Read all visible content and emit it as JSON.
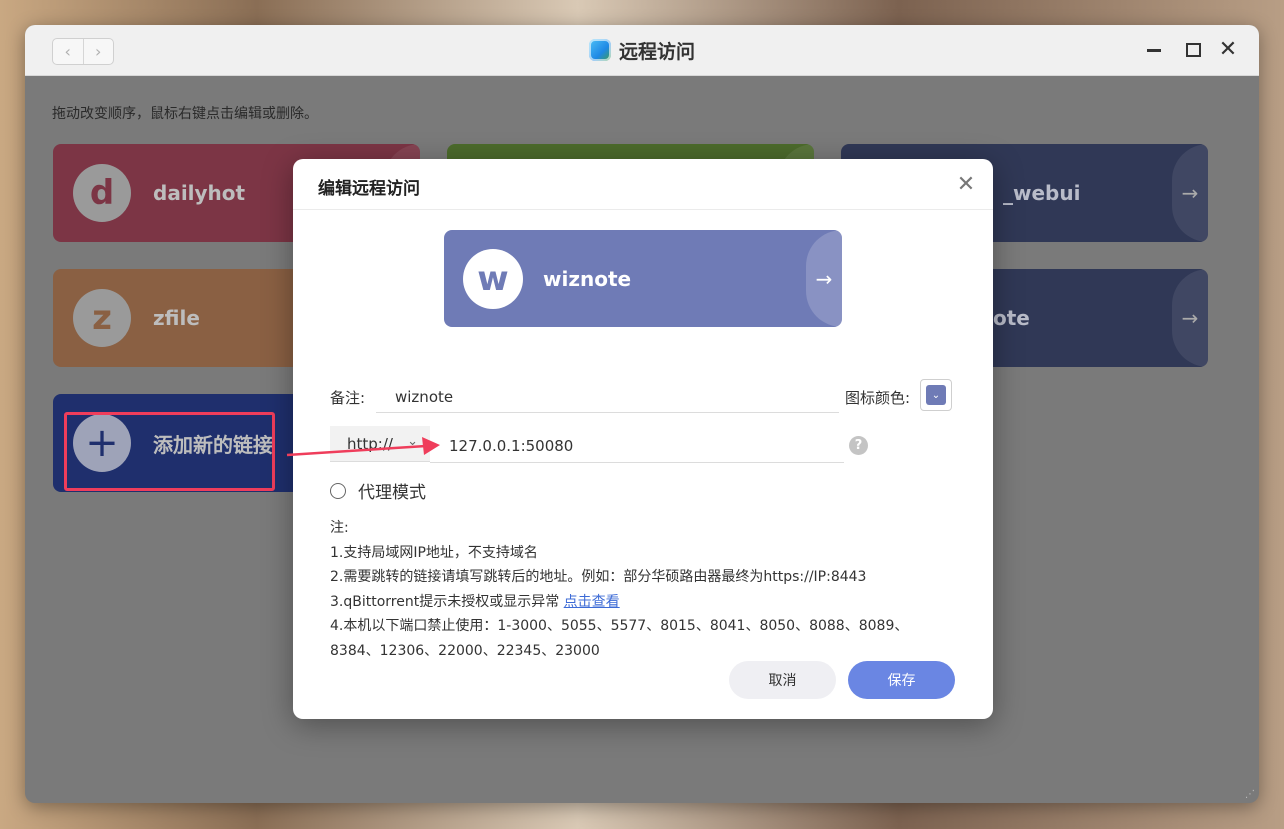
{
  "window": {
    "title": "远程访问",
    "nav_back": "‹",
    "nav_forward": "›",
    "close_glyph": "✕"
  },
  "hint": "拖动改变顺序，鼠标右键点击编辑或删除。",
  "cards": [
    {
      "letter": "d",
      "label": "dailyhot",
      "color": "#7c3545"
    },
    {
      "letter": "",
      "label": "",
      "color": "#4c6b2c"
    },
    {
      "letter": "",
      "label": "_webui",
      "color": "#303856"
    },
    {
      "letter": "z",
      "label": "zfile",
      "color": "#8a6043"
    },
    {
      "letter": "",
      "label": "ote",
      "color": "#303856"
    },
    {
      "letter": "+",
      "label": "添加新的链接",
      "color": "#1f2f6d"
    }
  ],
  "arrow_glyph": "→",
  "modal": {
    "title": "编辑远程访问",
    "close_glyph": "✕",
    "preview": {
      "letter": "w",
      "label": "wiznote",
      "color": "#6f7bb6"
    },
    "remark_label": "备注:",
    "remark_value": "wiznote",
    "icon_color_label": "图标颜色:",
    "icon_color": "#6f7bb6",
    "protocol": "http://",
    "address_value": "127.0.0.1:50080",
    "help_glyph": "?",
    "proxy_mode_label": "代理模式",
    "notes_title": "注:",
    "notes": [
      "1.支持局域网IP地址，不支持域名",
      "2.需要跳转的链接请填写跳转后的地址。例如：部分华硕路由器最终为https://IP:8443",
      "3.qBittorrent提示未授权或显示异常",
      "4.本机以下端口禁止使用：1-3000、5055、5577、8015、8041、8050、8088、8089、",
      "8384、12306、22000、22345、23000"
    ],
    "notes_link": "点击查看",
    "cancel_label": "取消",
    "save_label": "保存"
  },
  "colors": {
    "highlight": "#ef3d5b",
    "accent": "#6a86e3"
  }
}
